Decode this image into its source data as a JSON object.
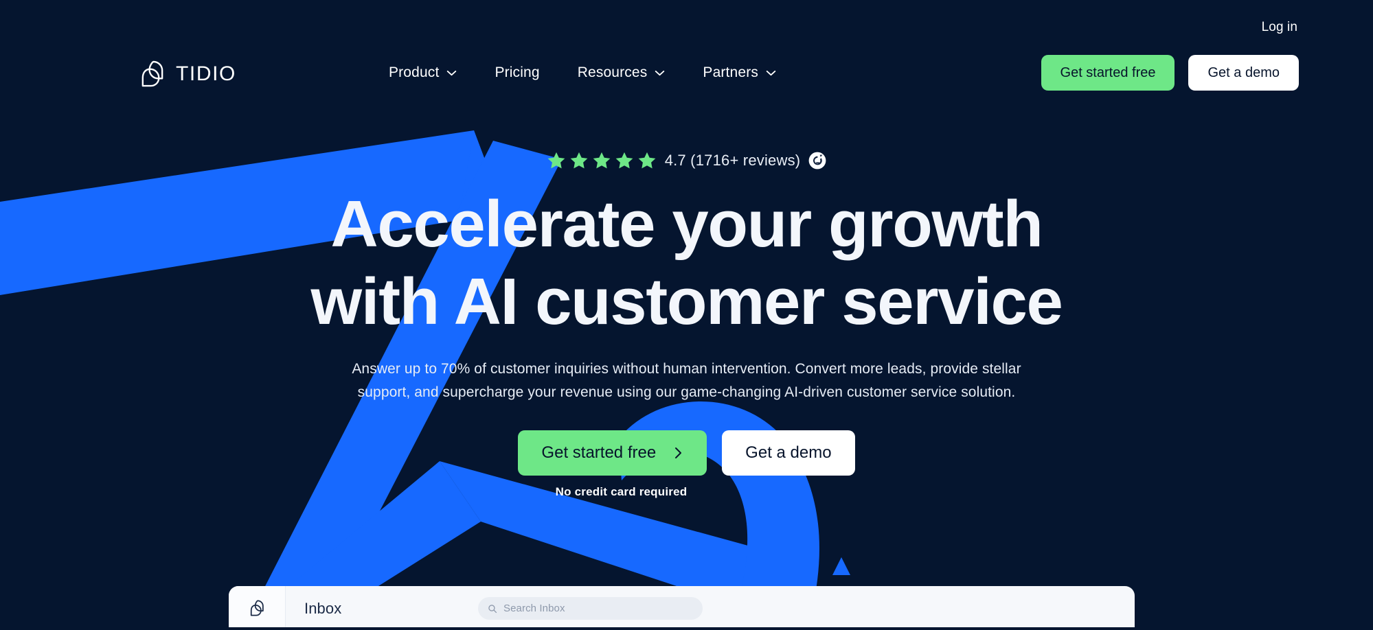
{
  "brand": {
    "name": "TIDIO",
    "logo_icon": "tidio-chat-bubbles-icon",
    "accent_green": "#6ee787",
    "accent_blue": "#1769ff",
    "background": "#05152f"
  },
  "header": {
    "login_label": "Log in",
    "nav": [
      {
        "label": "Product",
        "has_dropdown": true,
        "icon": "chevron-down-icon"
      },
      {
        "label": "Pricing",
        "has_dropdown": false,
        "icon": ""
      },
      {
        "label": "Resources",
        "has_dropdown": true,
        "icon": "chevron-down-icon"
      },
      {
        "label": "Partners",
        "has_dropdown": true,
        "icon": "chevron-down-icon"
      }
    ],
    "cta_primary": "Get started free",
    "cta_secondary": "Get a demo"
  },
  "hero": {
    "rating": {
      "stars": 5,
      "score": "4.7",
      "text": "4.7 (1716+ reviews)",
      "badge_icon": "g2-logo-icon"
    },
    "headline_line1": "Accelerate your growth",
    "headline_line2": "with AI customer service",
    "subhead_line1": "Answer up to 70% of customer inquiries without human intervention. Convert more leads, provide stellar",
    "subhead_line2": "support, and supercharge your revenue using our game-changing AI-driven customer service solution.",
    "cta_primary": "Get started free",
    "cta_primary_icon": "chevron-right-icon",
    "cta_secondary": "Get a demo",
    "disclaimer": "No credit card required"
  },
  "inbox_preview": {
    "logo_icon": "tidio-chat-bubbles-icon",
    "title": "Inbox",
    "search_placeholder": "Search Inbox",
    "search_icon": "search-icon",
    "search_value": ""
  }
}
